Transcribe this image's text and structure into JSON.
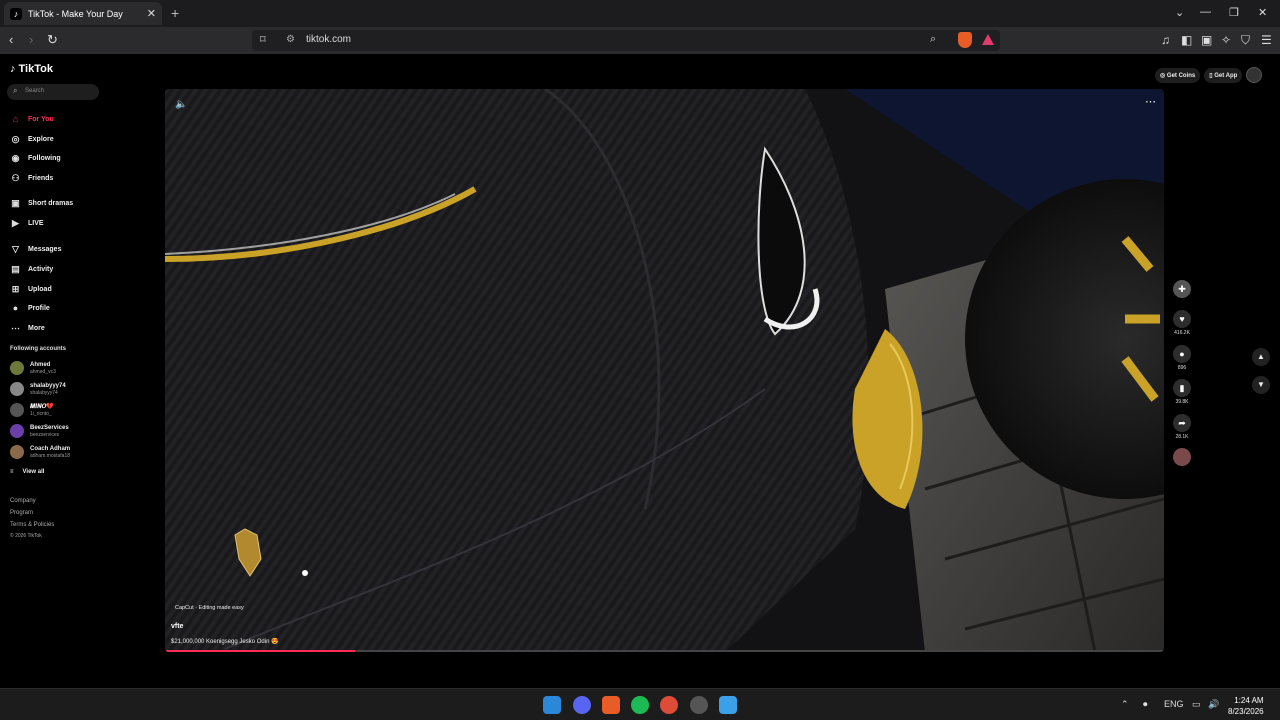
{
  "browser": {
    "tab_title": "TikTok - Make Your Day",
    "tab_close": "✕",
    "new_tab": "+",
    "url": "tiktok.com"
  },
  "tiktok": {
    "logo": "TikTok",
    "search_placeholder": "Search",
    "nav": [
      {
        "label": "For You",
        "icon": "home-icon",
        "glyph": "⌂"
      },
      {
        "label": "Explore",
        "icon": "compass-icon",
        "glyph": "◎"
      },
      {
        "label": "Following",
        "icon": "following-icon",
        "glyph": "◉"
      },
      {
        "label": "Friends",
        "icon": "friends-icon",
        "glyph": "⚇"
      },
      {
        "label": "Short dramas",
        "icon": "film-icon",
        "glyph": "▣"
      },
      {
        "label": "LIVE",
        "icon": "live-icon",
        "glyph": "▶"
      },
      {
        "label": "Messages",
        "icon": "messages-icon",
        "glyph": "▽"
      },
      {
        "label": "Activity",
        "icon": "activity-icon",
        "glyph": "▤"
      },
      {
        "label": "Upload",
        "icon": "upload-icon",
        "glyph": "⊞"
      },
      {
        "label": "Profile",
        "icon": "profile-icon",
        "glyph": "●"
      },
      {
        "label": "More",
        "icon": "more-icon",
        "glyph": "⋯"
      }
    ],
    "following_header": "Following accounts",
    "accounts": [
      {
        "name": "Ahmed",
        "handle": "ahmed_vc3",
        "color": "#6b7a3a"
      },
      {
        "name": "shalabyyy74",
        "handle": "shalabyyy74",
        "color": "#888"
      },
      {
        "name": "𝑴𝑰𝑵𝑶💔",
        "handle": "1i_ricnto_",
        "color": "#555"
      },
      {
        "name": "BeezServices",
        "handle": "beezservices",
        "color": "#6a3fa8"
      },
      {
        "name": "Coach Adham",
        "handle": "adham.mostafa18",
        "color": "#8a6a4a"
      }
    ],
    "view_all": "View all",
    "footer": [
      "Company",
      "Program",
      "Terms & Policies",
      "© 2026 TikTok"
    ],
    "get_coins": "Get Coins",
    "get_app": "Get App"
  },
  "video": {
    "capcut": "CapCut · Editing made easy",
    "username": "vfte",
    "caption": "$21,000,000 Koenigsegg Jesko Odin 😍",
    "progress": 0.19,
    "likes": "416.2K",
    "comments": "896",
    "saves": "39.8K",
    "shares": "28.1K"
  },
  "taskbar": {
    "lang": "ENG",
    "time": "1:24 AM",
    "date": "8/23/2026"
  },
  "colors": {
    "accent": "#fe2c55",
    "carbon": "#1a1a1c",
    "gold": "#c9a227"
  }
}
